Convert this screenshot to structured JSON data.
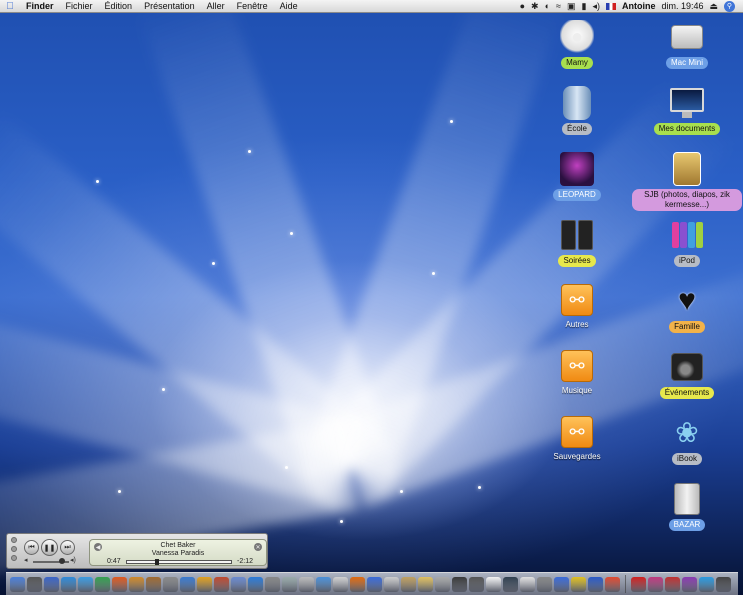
{
  "menubar": {
    "app": "Finder",
    "items": [
      "Fichier",
      "Édition",
      "Présentation",
      "Aller",
      "Fenêtre",
      "Aide"
    ],
    "user": "Antoine",
    "clock": "dim. 19:46"
  },
  "desktop": {
    "column_left": [
      {
        "label": "Mamy",
        "icon": "teddy-bear-icon",
        "label_color": "#a8df4e"
      },
      {
        "label": "École",
        "icon": "cylinder-speaker-icon",
        "label_color": "#b7bcc5"
      },
      {
        "label": "LEOPARD",
        "icon": "leopard-dvd-icon",
        "label_color": "#6d9fe6"
      },
      {
        "label": "Soirées",
        "icon": "speakers-icon",
        "label_color": "#e7e84c"
      },
      {
        "label": "Autres",
        "icon": "usb-drive-icon",
        "label_color": "transparent"
      },
      {
        "label": "Musique",
        "icon": "usb-drive-icon",
        "label_color": "transparent"
      },
      {
        "label": "Sauvegardes",
        "icon": "usb-drive-icon",
        "label_color": "transparent"
      }
    ],
    "column_right": [
      {
        "label": "Mac Mini",
        "icon": "mac-mini-icon",
        "label_color": "#6d9fe6"
      },
      {
        "label": "Mes documents",
        "icon": "imac-icon",
        "label_color": "#a8df4e"
      },
      {
        "label": "SJB (photos, diapos, zik kermesse...)",
        "icon": "photo-folder-icon",
        "label_color": "#d49ade"
      },
      {
        "label": "iPod",
        "icon": "ipod-icon",
        "label_color": "#b7bcc5"
      },
      {
        "label": "Famille",
        "icon": "tux-heart-icon",
        "label_color": "#f2b24a"
      },
      {
        "label": "Événements",
        "icon": "camera-speaker-icon",
        "label_color": "#e7e84c"
      },
      {
        "label": "iBook",
        "icon": "pinwheel-icon",
        "label_color": "#b7bcc5"
      },
      {
        "label": "BAZAR",
        "icon": "mac-pro-icon",
        "label_color": "#6d9fe6"
      }
    ]
  },
  "player": {
    "track": "Chet Baker",
    "artist": "Vanessa Paradis",
    "elapsed": "0:47",
    "remaining": "-2:12",
    "progress_fraction": 0.27,
    "volume_fraction": 0.8
  },
  "dock": {
    "colors": [
      "#4b7fd8",
      "#555",
      "#3a64c8",
      "#2f8ad8",
      "#3b9ae0",
      "#35a050",
      "#e05a20",
      "#d08a2a",
      "#a06a30",
      "#8a8a8a",
      "#3a7ad0",
      "#e0a020",
      "#c04a30",
      "#6a8ad0",
      "#2a7ad8",
      "#888",
      "#9aa",
      "#bbb",
      "#4b90d8",
      "#d0d0d0",
      "#e06a10",
      "#3a6ad8",
      "#ccc",
      "#c0a060",
      "#e0c060",
      "#aaa",
      "#3a3a3a",
      "#555",
      "#f2f2f2",
      "#304050",
      "#e0e0e0",
      "#888",
      "#3a6ad8",
      "#e0c020",
      "#2a5ac8",
      "#e04a30",
      "#d02020",
      "#c03a80",
      "#c03030",
      "#8a3ab0",
      "#2a9ae0",
      "#444"
    ]
  }
}
